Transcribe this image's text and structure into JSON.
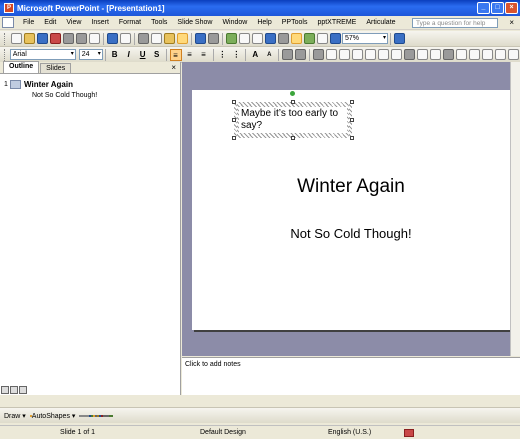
{
  "window": {
    "title": "Microsoft PowerPoint - [Presentation1]"
  },
  "menu": {
    "items": [
      "File",
      "Edit",
      "View",
      "Insert",
      "Format",
      "Tools",
      "Slide Show",
      "Window",
      "Help",
      "PPTools",
      "pptXTREME",
      "Articulate"
    ],
    "help_placeholder": "Type a question for help"
  },
  "toolbar": {
    "zoom": "57%",
    "font_name": "Arial",
    "font_size": "24"
  },
  "outline_pane": {
    "tabs": [
      "Outline",
      "Slides"
    ],
    "slide_number": "1",
    "slide_title": "Winter Again",
    "bullet": "Not So Cold Though!"
  },
  "slide": {
    "textbox_text": "Maybe it’s too early to say?",
    "title": "Winter Again",
    "subtitle": "Not So Cold Though!"
  },
  "notes": {
    "placeholder": "Click to add notes"
  },
  "drawing_toolbar": {
    "draw_label": "Draw ▾",
    "autoshapes_label": "AutoShapes ▾"
  },
  "status": {
    "slide_info": "Slide 1 of 1",
    "design": "Default Design",
    "language": "English (U.S.)"
  }
}
